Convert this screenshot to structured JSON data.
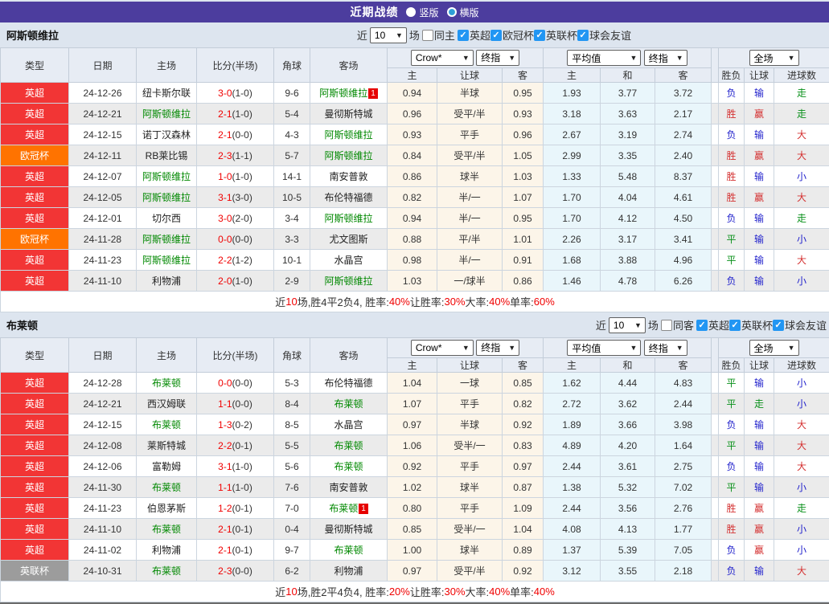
{
  "title_bar": {
    "title": "近期战绩",
    "layout_options": [
      {
        "label": "竖版",
        "selected": false
      },
      {
        "label": "横版",
        "selected": true
      }
    ]
  },
  "colors": {
    "titlebar_bg": "#4c3d9e",
    "league_epl": "#f23535",
    "league_ucl": "#ff7300",
    "league_efl": "#9c9c9c",
    "self_team_green": "#008800",
    "score_red": "#f00000",
    "win_red": "#d43030",
    "lose_blue": "#2222cc",
    "draw_green": "#089019",
    "crown_col_bg": "#fcf5e9",
    "avg_col_bg": "#e9f6fb",
    "checkbox_blue": "#2296f3"
  },
  "table_header": {
    "match_cols": [
      "类型",
      "日期",
      "主场",
      "比分(半场)",
      "角球",
      "客场"
    ],
    "crown_select": "Crow*",
    "crown_final": "终指",
    "crown_cols": [
      "主",
      "让球",
      "客"
    ],
    "avg_select": "平均值",
    "avg_final": "终指",
    "avg_cols": [
      "主",
      "和",
      "客"
    ],
    "scope_select": "全场",
    "result_cols": [
      "胜负",
      "让球",
      "进球数"
    ]
  },
  "sections": [
    {
      "team": "阿斯顿维拉",
      "filter": {
        "prefix": "近",
        "count": "10",
        "suffix": "场",
        "same": {
          "label": "同主",
          "checked": false
        },
        "leagues": [
          {
            "label": "英超",
            "checked": true
          },
          {
            "label": "欧冠杯",
            "checked": true
          },
          {
            "label": "英联杯",
            "checked": true
          },
          {
            "label": "球会友谊",
            "checked": true
          }
        ]
      },
      "rows": [
        {
          "league": "英超",
          "type": "epl",
          "date": "24-12-26",
          "home": "纽卡斯尔联",
          "home_self": false,
          "score": "3-0",
          "half": "(1-0)",
          "corners": "9-6",
          "away": "阿斯顿维拉",
          "away_self": true,
          "away_flag": "1",
          "crown": [
            "0.94",
            "半球",
            "0.95"
          ],
          "avg": [
            "1.93",
            "3.77",
            "3.72"
          ],
          "results": [
            {
              "t": "负",
              "c": "blue"
            },
            {
              "t": "输",
              "c": "blue"
            },
            {
              "t": "走",
              "c": "green"
            }
          ]
        },
        {
          "league": "英超",
          "type": "epl",
          "date": "24-12-21",
          "home": "阿斯顿维拉",
          "home_self": true,
          "score": "2-1",
          "half": "(1-0)",
          "corners": "5-4",
          "away": "曼彻斯特城",
          "away_self": false,
          "crown": [
            "0.96",
            "受平/半",
            "0.93"
          ],
          "avg": [
            "3.18",
            "3.63",
            "2.17"
          ],
          "results": [
            {
              "t": "胜",
              "c": "red"
            },
            {
              "t": "赢",
              "c": "red"
            },
            {
              "t": "走",
              "c": "green"
            }
          ]
        },
        {
          "league": "英超",
          "type": "epl",
          "date": "24-12-15",
          "home": "诺丁汉森林",
          "home_self": false,
          "score": "2-1",
          "half": "(0-0)",
          "corners": "4-3",
          "away": "阿斯顿维拉",
          "away_self": true,
          "crown": [
            "0.93",
            "平手",
            "0.96"
          ],
          "avg": [
            "2.67",
            "3.19",
            "2.74"
          ],
          "results": [
            {
              "t": "负",
              "c": "blue"
            },
            {
              "t": "输",
              "c": "blue"
            },
            {
              "t": "大",
              "c": "red"
            }
          ]
        },
        {
          "league": "欧冠杯",
          "type": "ucl",
          "date": "24-12-11",
          "home": "RB莱比锡",
          "home_self": false,
          "score": "2-3",
          "half": "(1-1)",
          "corners": "5-7",
          "away": "阿斯顿维拉",
          "away_self": true,
          "crown": [
            "0.84",
            "受平/半",
            "1.05"
          ],
          "avg": [
            "2.99",
            "3.35",
            "2.40"
          ],
          "results": [
            {
              "t": "胜",
              "c": "red"
            },
            {
              "t": "赢",
              "c": "red"
            },
            {
              "t": "大",
              "c": "red"
            }
          ]
        },
        {
          "league": "英超",
          "type": "epl",
          "date": "24-12-07",
          "home": "阿斯顿维拉",
          "home_self": true,
          "score": "1-0",
          "half": "(1-0)",
          "corners": "14-1",
          "away": "南安普敦",
          "away_self": false,
          "crown": [
            "0.86",
            "球半",
            "1.03"
          ],
          "avg": [
            "1.33",
            "5.48",
            "8.37"
          ],
          "results": [
            {
              "t": "胜",
              "c": "red"
            },
            {
              "t": "输",
              "c": "blue"
            },
            {
              "t": "小",
              "c": "blue"
            }
          ]
        },
        {
          "league": "英超",
          "type": "epl",
          "date": "24-12-05",
          "home": "阿斯顿维拉",
          "home_self": true,
          "score": "3-1",
          "half": "(3-0)",
          "corners": "10-5",
          "away": "布伦特福德",
          "away_self": false,
          "crown": [
            "0.82",
            "半/一",
            "1.07"
          ],
          "avg": [
            "1.70",
            "4.04",
            "4.61"
          ],
          "results": [
            {
              "t": "胜",
              "c": "red"
            },
            {
              "t": "赢",
              "c": "red"
            },
            {
              "t": "大",
              "c": "red"
            }
          ]
        },
        {
          "league": "英超",
          "type": "epl",
          "date": "24-12-01",
          "home": "切尔西",
          "home_self": false,
          "score": "3-0",
          "half": "(2-0)",
          "corners": "3-4",
          "away": "阿斯顿维拉",
          "away_self": true,
          "crown": [
            "0.94",
            "半/一",
            "0.95"
          ],
          "avg": [
            "1.70",
            "4.12",
            "4.50"
          ],
          "results": [
            {
              "t": "负",
              "c": "blue"
            },
            {
              "t": "输",
              "c": "blue"
            },
            {
              "t": "走",
              "c": "green"
            }
          ]
        },
        {
          "league": "欧冠杯",
          "type": "ucl",
          "date": "24-11-28",
          "home": "阿斯顿维拉",
          "home_self": true,
          "score": "0-0",
          "half": "(0-0)",
          "corners": "3-3",
          "away": "尤文图斯",
          "away_self": false,
          "crown": [
            "0.88",
            "平/半",
            "1.01"
          ],
          "avg": [
            "2.26",
            "3.17",
            "3.41"
          ],
          "results": [
            {
              "t": "平",
              "c": "green"
            },
            {
              "t": "输",
              "c": "blue"
            },
            {
              "t": "小",
              "c": "blue"
            }
          ]
        },
        {
          "league": "英超",
          "type": "epl",
          "date": "24-11-23",
          "home": "阿斯顿维拉",
          "home_self": true,
          "score": "2-2",
          "half": "(1-2)",
          "corners": "10-1",
          "away": "水晶宫",
          "away_self": false,
          "crown": [
            "0.98",
            "半/一",
            "0.91"
          ],
          "avg": [
            "1.68",
            "3.88",
            "4.96"
          ],
          "results": [
            {
              "t": "平",
              "c": "green"
            },
            {
              "t": "输",
              "c": "blue"
            },
            {
              "t": "大",
              "c": "red"
            }
          ]
        },
        {
          "league": "英超",
          "type": "epl",
          "date": "24-11-10",
          "home": "利物浦",
          "home_self": false,
          "score": "2-0",
          "half": "(1-0)",
          "corners": "2-9",
          "away": "阿斯顿维拉",
          "away_self": true,
          "crown": [
            "1.03",
            "一/球半",
            "0.86"
          ],
          "avg": [
            "1.46",
            "4.78",
            "6.26"
          ],
          "results": [
            {
              "t": "负",
              "c": "blue"
            },
            {
              "t": "输",
              "c": "blue"
            },
            {
              "t": "小",
              "c": "blue"
            }
          ]
        }
      ],
      "summary": [
        {
          "t": "近",
          "c": "dark"
        },
        {
          "t": "10",
          "c": "red"
        },
        {
          "t": "场,胜4平2负4, 胜率:",
          "c": "dark"
        },
        {
          "t": "40%",
          "c": "red"
        },
        {
          "t": " 让胜率:",
          "c": "dark"
        },
        {
          "t": "30%",
          "c": "red"
        },
        {
          "t": " 大率:",
          "c": "dark"
        },
        {
          "t": "40%",
          "c": "red"
        },
        {
          "t": " 单率:",
          "c": "dark"
        },
        {
          "t": "60%",
          "c": "red"
        }
      ]
    },
    {
      "team": "布莱顿",
      "filter": {
        "prefix": "近",
        "count": "10",
        "suffix": "场",
        "same": {
          "label": "同客",
          "checked": false
        },
        "leagues": [
          {
            "label": "英超",
            "checked": true
          },
          {
            "label": "英联杯",
            "checked": true
          },
          {
            "label": "球会友谊",
            "checked": true
          }
        ]
      },
      "rows": [
        {
          "league": "英超",
          "type": "epl",
          "date": "24-12-28",
          "home": "布莱顿",
          "home_self": true,
          "score": "0-0",
          "half": "(0-0)",
          "corners": "5-3",
          "away": "布伦特福德",
          "away_self": false,
          "crown": [
            "1.04",
            "一球",
            "0.85"
          ],
          "avg": [
            "1.62",
            "4.44",
            "4.83"
          ],
          "results": [
            {
              "t": "平",
              "c": "green"
            },
            {
              "t": "输",
              "c": "blue"
            },
            {
              "t": "小",
              "c": "blue"
            }
          ]
        },
        {
          "league": "英超",
          "type": "epl",
          "date": "24-12-21",
          "home": "西汉姆联",
          "home_self": false,
          "score": "1-1",
          "half": "(0-0)",
          "corners": "8-4",
          "away": "布莱顿",
          "away_self": true,
          "crown": [
            "1.07",
            "平手",
            "0.82"
          ],
          "avg": [
            "2.72",
            "3.62",
            "2.44"
          ],
          "results": [
            {
              "t": "平",
              "c": "green"
            },
            {
              "t": "走",
              "c": "green"
            },
            {
              "t": "小",
              "c": "blue"
            }
          ]
        },
        {
          "league": "英超",
          "type": "epl",
          "date": "24-12-15",
          "home": "布莱顿",
          "home_self": true,
          "score": "1-3",
          "half": "(0-2)",
          "corners": "8-5",
          "away": "水晶宫",
          "away_self": false,
          "crown": [
            "0.97",
            "半球",
            "0.92"
          ],
          "avg": [
            "1.89",
            "3.66",
            "3.98"
          ],
          "results": [
            {
              "t": "负",
              "c": "blue"
            },
            {
              "t": "输",
              "c": "blue"
            },
            {
              "t": "大",
              "c": "red"
            }
          ]
        },
        {
          "league": "英超",
          "type": "epl",
          "date": "24-12-08",
          "home": "莱斯特城",
          "home_self": false,
          "score": "2-2",
          "half": "(0-1)",
          "corners": "5-5",
          "away": "布莱顿",
          "away_self": true,
          "crown": [
            "1.06",
            "受半/一",
            "0.83"
          ],
          "avg": [
            "4.89",
            "4.20",
            "1.64"
          ],
          "results": [
            {
              "t": "平",
              "c": "green"
            },
            {
              "t": "输",
              "c": "blue"
            },
            {
              "t": "大",
              "c": "red"
            }
          ]
        },
        {
          "league": "英超",
          "type": "epl",
          "date": "24-12-06",
          "home": "富勒姆",
          "home_self": false,
          "score": "3-1",
          "half": "(1-0)",
          "corners": "5-6",
          "away": "布莱顿",
          "away_self": true,
          "crown": [
            "0.92",
            "平手",
            "0.97"
          ],
          "avg": [
            "2.44",
            "3.61",
            "2.75"
          ],
          "results": [
            {
              "t": "负",
              "c": "blue"
            },
            {
              "t": "输",
              "c": "blue"
            },
            {
              "t": "大",
              "c": "red"
            }
          ]
        },
        {
          "league": "英超",
          "type": "epl",
          "date": "24-11-30",
          "home": "布莱顿",
          "home_self": true,
          "score": "1-1",
          "half": "(1-0)",
          "corners": "7-6",
          "away": "南安普敦",
          "away_self": false,
          "crown": [
            "1.02",
            "球半",
            "0.87"
          ],
          "avg": [
            "1.38",
            "5.32",
            "7.02"
          ],
          "results": [
            {
              "t": "平",
              "c": "green"
            },
            {
              "t": "输",
              "c": "blue"
            },
            {
              "t": "小",
              "c": "blue"
            }
          ]
        },
        {
          "league": "英超",
          "type": "epl",
          "date": "24-11-23",
          "home": "伯恩茅斯",
          "home_self": false,
          "score": "1-2",
          "half": "(0-1)",
          "corners": "7-0",
          "away": "布莱顿",
          "away_self": true,
          "away_flag": "1",
          "crown": [
            "0.80",
            "平手",
            "1.09"
          ],
          "avg": [
            "2.44",
            "3.56",
            "2.76"
          ],
          "results": [
            {
              "t": "胜",
              "c": "red"
            },
            {
              "t": "赢",
              "c": "red"
            },
            {
              "t": "走",
              "c": "green"
            }
          ]
        },
        {
          "league": "英超",
          "type": "epl",
          "date": "24-11-10",
          "home": "布莱顿",
          "home_self": true,
          "score": "2-1",
          "half": "(0-1)",
          "corners": "0-4",
          "away": "曼彻斯特城",
          "away_self": false,
          "crown": [
            "0.85",
            "受半/一",
            "1.04"
          ],
          "avg": [
            "4.08",
            "4.13",
            "1.77"
          ],
          "results": [
            {
              "t": "胜",
              "c": "red"
            },
            {
              "t": "赢",
              "c": "red"
            },
            {
              "t": "小",
              "c": "blue"
            }
          ]
        },
        {
          "league": "英超",
          "type": "epl",
          "date": "24-11-02",
          "home": "利物浦",
          "home_self": false,
          "score": "2-1",
          "half": "(0-1)",
          "corners": "9-7",
          "away": "布莱顿",
          "away_self": true,
          "crown": [
            "1.00",
            "球半",
            "0.89"
          ],
          "avg": [
            "1.37",
            "5.39",
            "7.05"
          ],
          "results": [
            {
              "t": "负",
              "c": "blue"
            },
            {
              "t": "赢",
              "c": "red"
            },
            {
              "t": "小",
              "c": "blue"
            }
          ]
        },
        {
          "league": "英联杯",
          "type": "efl",
          "date": "24-10-31",
          "home": "布莱顿",
          "home_self": true,
          "score": "2-3",
          "half": "(0-0)",
          "corners": "6-2",
          "away": "利物浦",
          "away_self": false,
          "crown": [
            "0.97",
            "受平/半",
            "0.92"
          ],
          "avg": [
            "3.12",
            "3.55",
            "2.18"
          ],
          "results": [
            {
              "t": "负",
              "c": "blue"
            },
            {
              "t": "输",
              "c": "blue"
            },
            {
              "t": "大",
              "c": "red"
            }
          ]
        }
      ],
      "summary": [
        {
          "t": "近",
          "c": "dark"
        },
        {
          "t": "10",
          "c": "red"
        },
        {
          "t": "场,胜2平4负4, 胜率:",
          "c": "dark"
        },
        {
          "t": "20%",
          "c": "red"
        },
        {
          "t": " 让胜率:",
          "c": "dark"
        },
        {
          "t": "30%",
          "c": "red"
        },
        {
          "t": " 大率:",
          "c": "dark"
        },
        {
          "t": "40%",
          "c": "red"
        },
        {
          "t": " 单率:",
          "c": "dark"
        },
        {
          "t": "40%",
          "c": "red"
        }
      ]
    }
  ]
}
